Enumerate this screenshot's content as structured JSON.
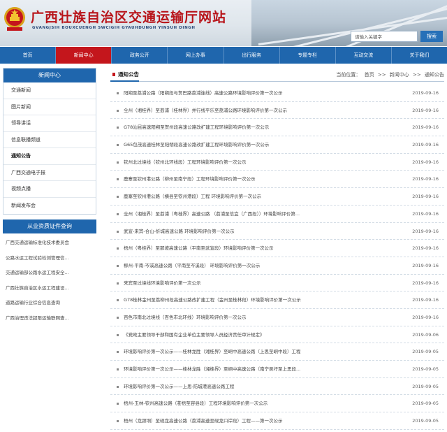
{
  "header": {
    "title": "广西壮族自治区交通运输厅网站",
    "subtitle": "GVANGJSIH BOUXCUENGH SWCIGIH GYAUHDUNGH YINSUH DINGH",
    "search_placeholder": "请输入关键字",
    "search_button": "搜索"
  },
  "nav": [
    {
      "label": "首页",
      "active": false
    },
    {
      "label": "新闻中心",
      "active": true
    },
    {
      "label": "政务公开",
      "active": false
    },
    {
      "label": "网上办事",
      "active": false
    },
    {
      "label": "出行服务",
      "active": false
    },
    {
      "label": "专题专栏",
      "active": false
    },
    {
      "label": "互动交流",
      "active": false
    },
    {
      "label": "关于我们",
      "active": false
    }
  ],
  "sidebar": {
    "title": "新闻中心",
    "items": [
      {
        "label": "交通新闻",
        "active": false
      },
      {
        "label": "图片新闻",
        "active": false
      },
      {
        "label": "领导讲话",
        "active": false
      },
      {
        "label": "信息联播频道",
        "active": false
      },
      {
        "label": "通知公告",
        "active": true
      },
      {
        "label": "广西交通电子报",
        "active": false
      },
      {
        "label": "视频点播",
        "active": false
      },
      {
        "label": "新闻发布会",
        "active": false
      }
    ],
    "qual_title": "从业资质证件查询",
    "qual_items": [
      "广西交通运输标准化技术委员会",
      "公路水运工程试验检测管理信...",
      "交通运输部公路水运工程安全...",
      "广西壮族自治区水运工程建设...",
      "道路运输行业综合信息查询",
      "广西治理违法超限运输联网查..."
    ]
  },
  "main": {
    "title": "通知公告",
    "breadcrumb": {
      "prefix": "当前位置：",
      "items": [
        "首页",
        "新闻中心",
        "通知公告"
      ],
      "separator": ">>"
    },
    "rows": [
      {
        "title": "阳朔至荔浦公路（阳朔段与贺巴路荔浦连线）高速公路环境影响评价第一次公示",
        "date": "2019-09-16"
      },
      {
        "title": "全州（湘桂界）至荔浦（桂林界）并行线平乐至荔浦公路环境影响评价第一次公示",
        "date": "2019-09-16"
      },
      {
        "title": "G78汕昆高速阳朔至贺州段高速公路改扩建工程环境影响评价第一次公示",
        "date": "2019-09-16"
      },
      {
        "title": "G65包茂高速桂林至阳朔段高速公路改扩建工程环境影响评价第一次公示",
        "date": "2019-09-16"
      },
      {
        "title": "钦州北过境线（钦州北环线段）工程环境影响评价第一次公示",
        "date": "2019-09-16"
      },
      {
        "title": "鹿寨至钦州港公路（柳州至南宁段）工程环境影响评价第一次公示",
        "date": "2019-09-16"
      },
      {
        "title": "鹿寨至钦州港公路（横县至钦州港段）工程 环境影响评价第一次公示",
        "date": "2019-09-16"
      },
      {
        "title": "全州（湘桂界）至荔浦（粤桂界）高速公路 （荔浦至信宜（广西段））环境影响评价第...",
        "date": "2019-09-16"
      },
      {
        "title": "武宣-来宾-合山-忻城高速公路 环境影响评价第一次公示",
        "date": "2019-09-16"
      },
      {
        "title": "梧州（粤桂界）至那坡高速公路（平南至武宣段）环境影响评价第一次公示",
        "date": "2019-09-16"
      },
      {
        "title": "柳州-平南-岑溪高速公路（平南至岑溪段） 环境影响评价第一次公示",
        "date": "2019-09-16"
      },
      {
        "title": "来宾至过境线环境影响评价第一次公示",
        "date": "2019-09-16"
      },
      {
        "title": "G78桂林金州至荔柳州段高速公路改扩建工程（金州至桂林段）环境影响评价第一次公示",
        "date": "2019-09-16"
      },
      {
        "title": "百色市南北过境线（百色市北环线）环境影响评价第一次公示",
        "date": "2019-09-16"
      },
      {
        "title": "《党政主要领导干部和国有企业单位主要领导人员经济责任审计规定》",
        "date": "2019-09-06"
      },
      {
        "title": "环境影响评价第一次公示——桂林龙胜（湘桂界）至峒中高速公路（上思至峒中段）工程",
        "date": "2019-09-05"
      },
      {
        "title": "环境影响评价第一次公示——桂林龙胜（湘桂界）至峒中高速公路（南宁吴圩至上思段...",
        "date": "2019-09-05"
      },
      {
        "title": "环境影响评价第一次公示——上思-防城港高速公路工程",
        "date": "2019-09-05"
      },
      {
        "title": "梧州-玉林-钦州高速公路（苍梧至容县段）工程环境影响评价第一次公示",
        "date": "2019-09-05"
      },
      {
        "title": "梧州（龙颈垌）至砚龙高速公路（荔浦高速至砚龙口岸段）工程——第一次公示",
        "date": "2019-09-05"
      }
    ]
  },
  "colors": {
    "primary_blue": "#1f66ad",
    "accent_red": "#c4161c",
    "title_red": "#b8141a"
  },
  "icons": {
    "emblem": "national-emblem-icon",
    "list_bullet": "square-bullet-icon"
  }
}
